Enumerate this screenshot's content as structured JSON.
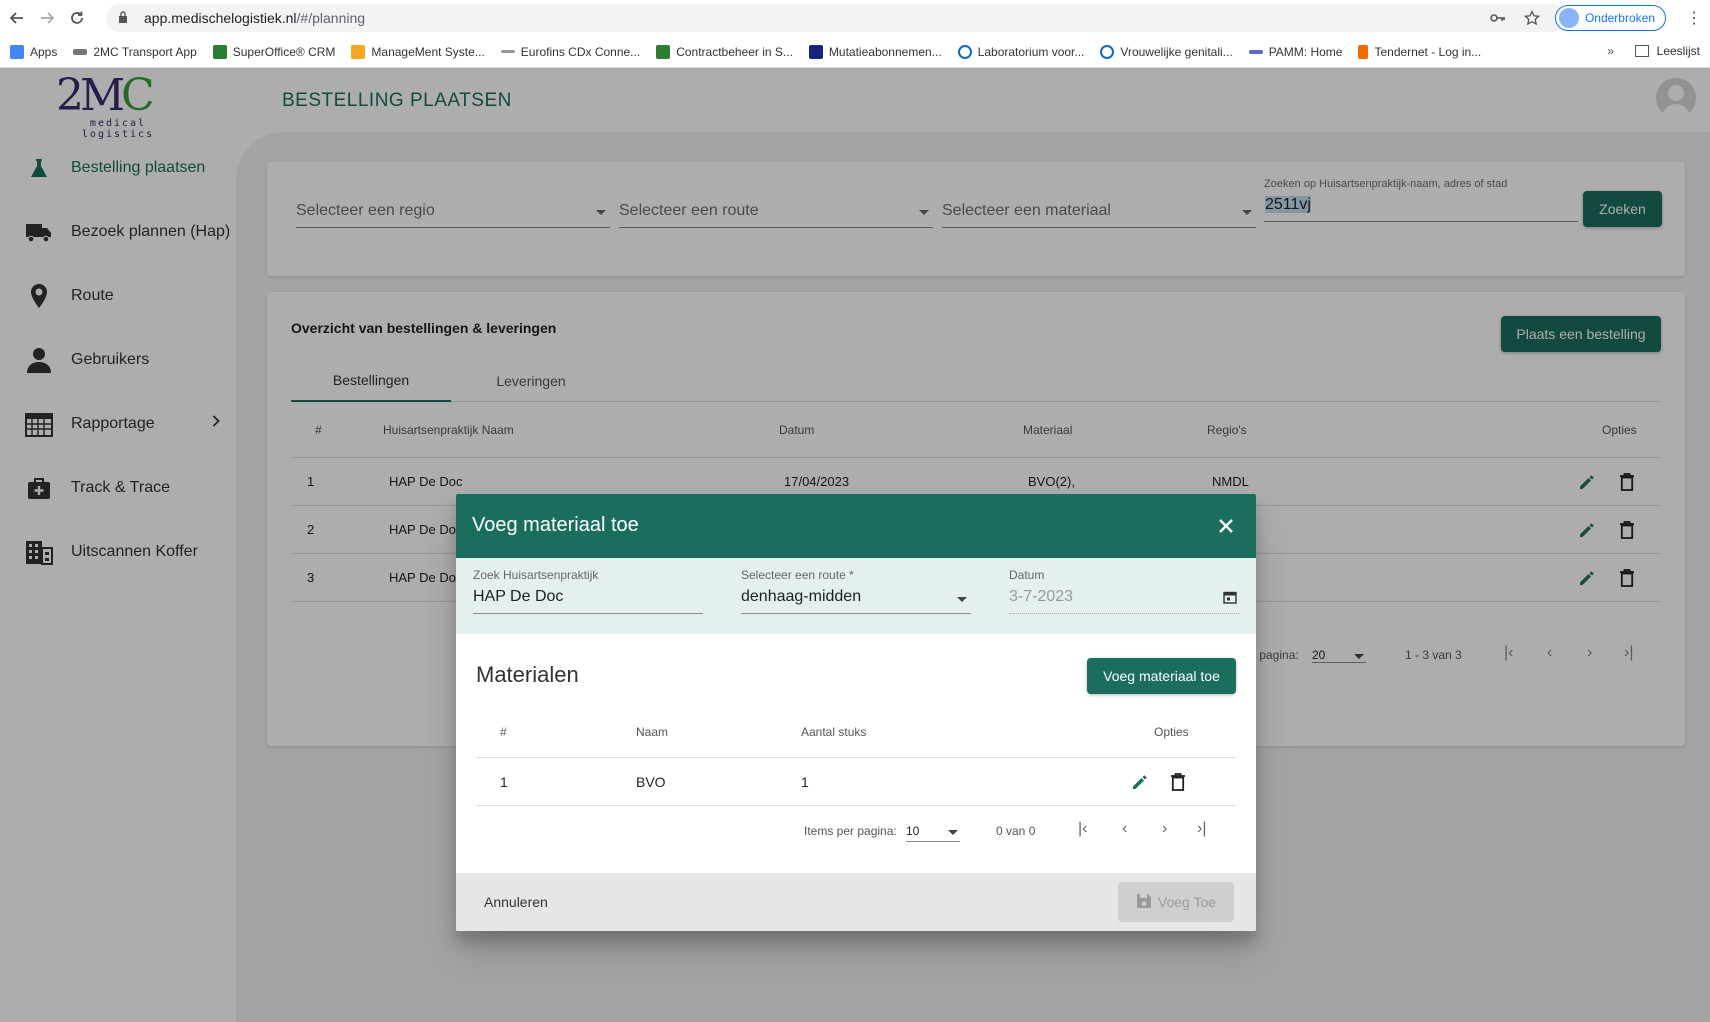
{
  "browser": {
    "url_host": "app.medischelogistiek.nl",
    "url_path": "/#/planning",
    "profile_label": "Onderbroken",
    "bookmarks": [
      {
        "label": "Apps",
        "color": "#4285f4"
      },
      {
        "label": "2MC Transport App",
        "color": "#777777"
      },
      {
        "label": "SuperOffice® CRM",
        "color": "#2e7d32"
      },
      {
        "label": "ManageMent Syste...",
        "color": "#f5a623"
      },
      {
        "label": "Eurofins CDx Conne...",
        "color": "#999999"
      },
      {
        "label": "Contractbeheer in S...",
        "color": "#2e7d32"
      },
      {
        "label": "Mutatieabonnemen...",
        "color": "#1a237e"
      },
      {
        "label": "Laboratorium voor...",
        "color": "#1565c0"
      },
      {
        "label": "Vrouwelijke genitali...",
        "color": "#1565c0"
      },
      {
        "label": "PAMM: Home",
        "color": "#5c6bc0"
      },
      {
        "label": "Tendernet - Log in...",
        "color": "#ef6c00"
      }
    ],
    "reading_list": "Leeslijst"
  },
  "app": {
    "logo_sub": "medical logistics",
    "page_title": "BESTELLING PLAATSEN",
    "accent": "#1b6e5e"
  },
  "sidebar": {
    "items": [
      {
        "label": "Bestelling plaatsen",
        "icon": "flask-icon"
      },
      {
        "label": "Bezoek plannen (Hap)",
        "icon": "truck-icon"
      },
      {
        "label": "Route",
        "icon": "map-pin-icon"
      },
      {
        "label": "Gebruikers",
        "icon": "person-icon"
      },
      {
        "label": "Rapportage",
        "icon": "calendar-grid-icon"
      },
      {
        "label": "Track & Trace",
        "icon": "medical-bag-icon"
      },
      {
        "label": "Uitscannen Koffer",
        "icon": "building-icon"
      }
    ]
  },
  "filters": {
    "region_placeholder": "Selecteer een regio",
    "route_placeholder": "Selecteer een route",
    "material_placeholder": "Selecteer een materiaal",
    "search_label": "Zoeken op Huisartsenpraktijk-naam, adres of stad",
    "search_value": "2511vj",
    "search_button": "Zoeken"
  },
  "overview": {
    "title": "Overzicht van bestellingen & leveringen",
    "place_order_button": "Plaats een bestelling",
    "tabs": [
      "Bestellingen",
      "Leveringen"
    ],
    "columns": [
      "#",
      "Huisartsenpraktijk Naam",
      "Datum",
      "Materiaal",
      "Regio's",
      "Opties"
    ],
    "rows": [
      {
        "num": "1",
        "name": "HAP De Doc",
        "date": "17/04/2023",
        "material": "BVO(2),",
        "region": "NMDL"
      },
      {
        "num": "2",
        "name": "HAP De Do"
      },
      {
        "num": "3",
        "name": "HAP De Do"
      }
    ],
    "pager_label": "r pagina:",
    "pager_size": "20",
    "pager_range": "1 - 3 van 3"
  },
  "modal": {
    "title": "Voeg materiaal toe",
    "practice_label": "Zoek Huisartsenpraktijk",
    "practice_value": "HAP De Doc",
    "route_label": "Selecteer een route *",
    "route_value": "denhaag-midden",
    "date_label": "Datum",
    "date_value": "3-7-2023",
    "materials_title": "Materialen",
    "add_material_button": "Voeg materiaal toe",
    "columns": [
      "#",
      "Naam",
      "Aantal stuks",
      "Opties"
    ],
    "rows": [
      {
        "num": "1",
        "name": "BVO",
        "count": "1"
      }
    ],
    "items_per_page_label": "Items per pagina:",
    "items_per_page": "10",
    "range": "0 van 0",
    "cancel_button": "Annuleren",
    "submit_button": "Voeg Toe"
  }
}
